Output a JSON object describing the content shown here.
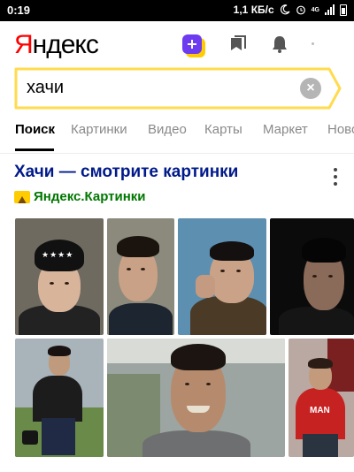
{
  "status_bar": {
    "time": "0:19",
    "net_speed": "1,1 КБ/с",
    "network_type": "4G",
    "icons": [
      "moon-icon",
      "alarm-icon",
      "signal-icon",
      "battery-icon"
    ]
  },
  "header": {
    "logo": "Яндекс",
    "icons": [
      "plus-icon",
      "collections-icon",
      "bell-icon"
    ]
  },
  "search": {
    "value": "хачи",
    "accent_color": "#ffdb4d"
  },
  "tabs": [
    {
      "label": "Поиск",
      "active": true
    },
    {
      "label": "Картинки"
    },
    {
      "label": "Видео"
    },
    {
      "label": "Карты"
    },
    {
      "label": "Маркет"
    },
    {
      "label": "Ново"
    }
  ],
  "result": {
    "title": "Хачи — смотрите картинки",
    "source": "Яндекс.Картинки",
    "title_color": "#001a8a",
    "source_color": "#007700"
  }
}
